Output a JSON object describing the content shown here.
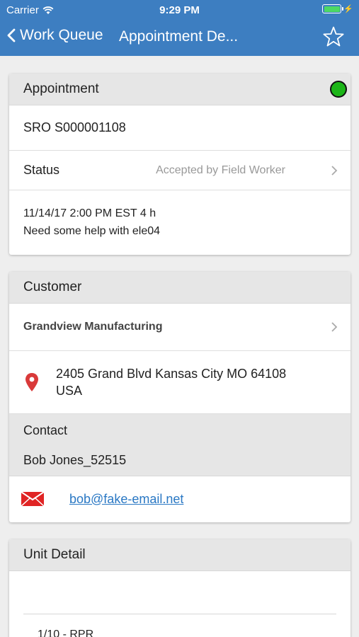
{
  "status_bar": {
    "carrier": "Carrier",
    "time": "9:29 PM"
  },
  "nav": {
    "back_label": "Work Queue",
    "title": "Appointment De..."
  },
  "appointment": {
    "heading": "Appointment",
    "status_color": "#1cb518",
    "sro": "SRO S000001108",
    "status_label": "Status",
    "status_value": "Accepted by Field Worker",
    "datetime": "11/14/17 2:00 PM EST 4 h",
    "description": "Need some help with ele04"
  },
  "customer": {
    "heading": "Customer",
    "name": "Grandview Manufacturing",
    "address_line1": "2405 Grand Blvd Kansas City MO 64108",
    "address_line2": "USA",
    "contact_heading": "Contact",
    "contact_name": "Bob Jones_52515",
    "email": "bob@fake-email.net"
  },
  "unit_detail": {
    "heading": "Unit Detail",
    "first_item": "1/10 - RPR"
  },
  "icons": {
    "back": "chevron-left-icon",
    "star": "star-icon",
    "chevron": "chevron-right-icon",
    "location": "map-pin-icon",
    "mail": "envelope-icon"
  }
}
